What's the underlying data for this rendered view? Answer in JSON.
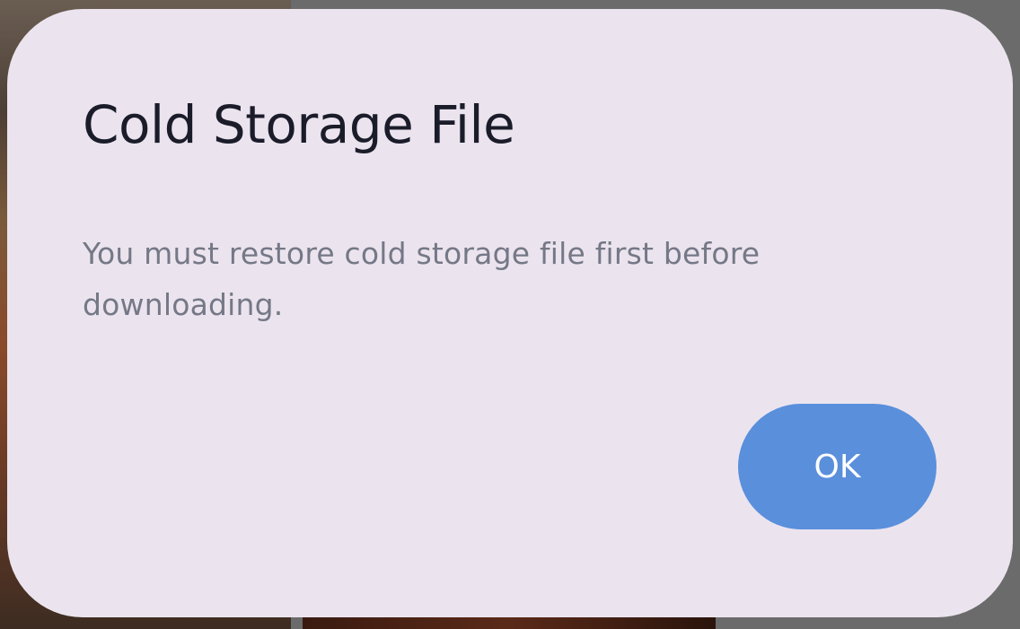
{
  "dialog": {
    "title": "Cold Storage File",
    "message": "You must restore cold storage file first before downloading.",
    "ok_label": "OK"
  },
  "colors": {
    "dialog_background": "#ebe4ee",
    "title_text": "#1b1c2a",
    "message_text": "#757886",
    "button_background": "#5a8fdc",
    "button_text": "#ffffff"
  }
}
